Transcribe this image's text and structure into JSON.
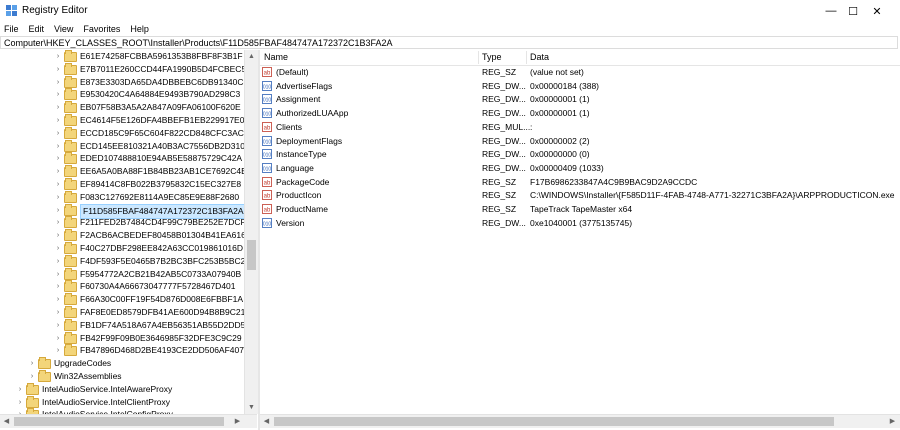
{
  "window": {
    "title": "Registry Editor",
    "minimize_glyph": "—",
    "maximize_glyph": "☐",
    "close_glyph": "✕"
  },
  "menu": [
    "File",
    "Edit",
    "View",
    "Favorites",
    "Help"
  ],
  "address": "Computer\\HKEY_CLASSES_ROOT\\Installer\\Products\\F11D585FBAF484747A172372C1B3FA2A",
  "tree": {
    "product_keys": [
      "E61E74258FCBBA5961353B8FBF8F3B1F",
      "E7B7011E260CCD44FA1990B5D4FCBEC5",
      "E873E3303DA65DA4DBBEBC6DB91340C6",
      "E9530420C4A64884E9493B790AD298C3",
      "EB07F58B3A5A2A847A09FA06100F620E",
      "EC4614F5E126DFA4BBEFB1EB229917E0",
      "ECCD185C9F65C604F822CD848CFC3AC5",
      "ECD145EE810321A40B3AC7556DB2D310",
      "EDED107488810E94AB5E58875729C42A",
      "EE6A5A0BA88F1B84BB23AB1CE7692C4B",
      "EF89414C8FB022B3795832C15EC327E8",
      "F083C127692E8114A9EC85E9E88F2680",
      "F11D585FBAF484747A172372C1B3FA2A",
      "F211FED2B7484CD4F99C79BE252E7DCF",
      "F2ACB6ACBEDEF80458B01304B41EA616",
      "F40C27DBF298EE842A63CC019861016D",
      "F4DF593F5E0465B7B2BC3BFC253B5BC2",
      "F5954772A2CB21B42AB5C0733A07940B",
      "F60730A4A66673047777F5728467D401",
      "F66A30C00FF19F54D876D008E6FBBF1A",
      "FAF8E0ED8579DFB41AE600D94B8B9C21",
      "FB1DF74A518A67A4EB56351AB55D2DD5",
      "FB42F99F09B0E3646985F32DFE3C9C29",
      "FB47896D468D2BE4193CE2DD506AF407"
    ],
    "selected": "F11D585FBAF484747A172372C1B3FA2A",
    "siblings": [
      "UpgradeCodes",
      "Win32Assemblies"
    ],
    "root_keys": [
      "IntelAudioService.IntelAwareProxy",
      "IntelAudioService.IntelClientProxy",
      "IntelAudioService.IntelConfigProxy"
    ]
  },
  "columns": {
    "name": "Name",
    "type": "Type",
    "data": "Data"
  },
  "values": [
    {
      "name": "(Default)",
      "type": "REG_SZ",
      "data": "(value not set)",
      "kind": "sz"
    },
    {
      "name": "AdvertiseFlags",
      "type": "REG_DW...",
      "data": "0x00000184 (388)",
      "kind": "bin"
    },
    {
      "name": "Assignment",
      "type": "REG_DW...",
      "data": "0x00000001 (1)",
      "kind": "bin"
    },
    {
      "name": "AuthorizedLUAApp",
      "type": "REG_DW...",
      "data": "0x00000001 (1)",
      "kind": "bin"
    },
    {
      "name": "Clients",
      "type": "REG_MUL...",
      "data": ":",
      "kind": "sz"
    },
    {
      "name": "DeploymentFlags",
      "type": "REG_DW...",
      "data": "0x00000002 (2)",
      "kind": "bin"
    },
    {
      "name": "InstanceType",
      "type": "REG_DW...",
      "data": "0x00000000 (0)",
      "kind": "bin"
    },
    {
      "name": "Language",
      "type": "REG_DW...",
      "data": "0x00000409 (1033)",
      "kind": "bin"
    },
    {
      "name": "PackageCode",
      "type": "REG_SZ",
      "data": "F17B6986233847A4C9B9BAC9D2A9CCDC",
      "kind": "sz"
    },
    {
      "name": "ProductIcon",
      "type": "REG_SZ",
      "data": "C:\\WINDOWS\\Installer\\{F585D11F-4FAB-4748-A771-32271C3BFA2A}\\ARPPRODUCTICON.exe",
      "kind": "sz"
    },
    {
      "name": "ProductName",
      "type": "REG_SZ",
      "data": "TapeTrack TapeMaster x64",
      "kind": "sz"
    },
    {
      "name": "Version",
      "type": "REG_DW...",
      "data": "0xe1040001 (3775135745)",
      "kind": "bin"
    }
  ],
  "colors": {
    "selection": "#cce8ff",
    "selection_border": "#99d1ff",
    "folder": "#f3d57a",
    "sz_icon": "#c0392b",
    "bin_icon": "#2b5fb4"
  }
}
